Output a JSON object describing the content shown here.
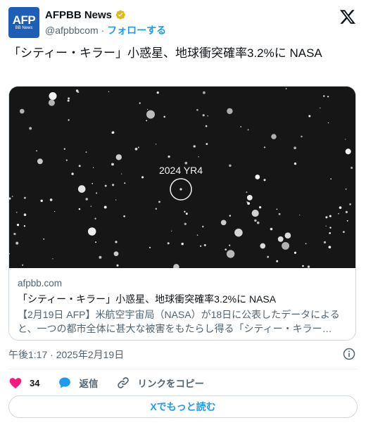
{
  "account": {
    "display_name": "AFPBB News",
    "handle": "@afpbbcom",
    "separator": " · ",
    "follow_label": "フォローする",
    "avatar_text": "AFP",
    "avatar_subtext": "BB News"
  },
  "tweet": {
    "text": "「シティー・キラー」小惑星、地球衝突確率3.2%に NASA"
  },
  "link_card": {
    "image_label": "2024 YR4",
    "domain": "afpbb.com",
    "title": "「シティー・キラー」小惑星、地球衝突確率3.2%に NASA",
    "description": "【2月19日 AFP】米航空宇宙局（NASA）が18日に公表したデータによると、一つの都市全体に甚大な被害をもたらし得る「シティー・キラー…"
  },
  "timestamp": "午後1:17 · 2025年2月19日",
  "actions": {
    "like_count": "34",
    "reply_label": "返信",
    "copy_link_label": "リンクをコピー"
  },
  "read_more_label": "Xでもっと読む",
  "colors": {
    "accent": "#1d9bf0",
    "like": "#f91880",
    "avatar_bg": "#1d5fb4",
    "verified": "#e2b719"
  }
}
